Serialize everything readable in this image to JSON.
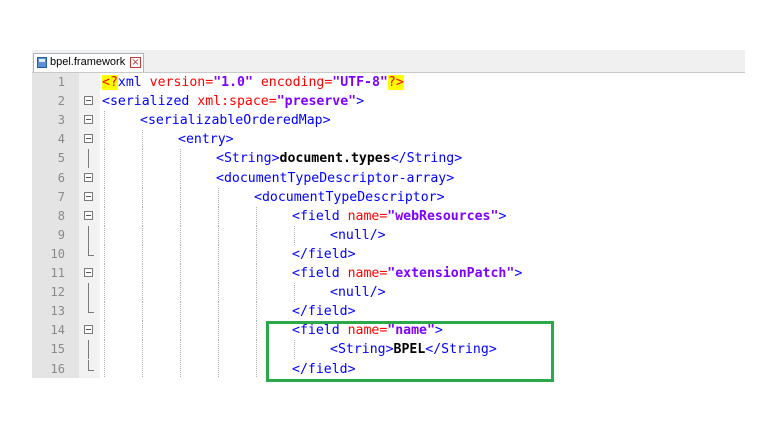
{
  "tab": {
    "label": "bpel.framework",
    "close_glyph": "×",
    "icon": "xml-file-icon",
    "close_icon": "close-icon"
  },
  "lines": [
    {
      "n": "1",
      "fold": "none",
      "indent": 0,
      "parts": [
        {
          "t": "<?",
          "c": "pi"
        },
        {
          "t": "xml",
          "c": "tag"
        },
        {
          "t": " version=",
          "c": "attr"
        },
        {
          "t": "\"1.0\"",
          "c": "val"
        },
        {
          "t": " encoding=",
          "c": "attr"
        },
        {
          "t": "\"UTF-8\"",
          "c": "val"
        },
        {
          "t": "?>",
          "c": "pi"
        }
      ]
    },
    {
      "n": "2",
      "fold": "box",
      "indent": 0,
      "parts": [
        {
          "t": "<serialized",
          "c": "tag"
        },
        {
          "t": " xml:space=",
          "c": "attr"
        },
        {
          "t": "\"preserve\"",
          "c": "val"
        },
        {
          "t": ">",
          "c": "tag"
        }
      ]
    },
    {
      "n": "3",
      "fold": "box",
      "indent": 1,
      "parts": [
        {
          "t": "<serializableOrderedMap>",
          "c": "tag"
        }
      ]
    },
    {
      "n": "4",
      "fold": "box",
      "indent": 2,
      "parts": [
        {
          "t": "<entry>",
          "c": "tag"
        }
      ]
    },
    {
      "n": "5",
      "fold": "line",
      "indent": 3,
      "parts": [
        {
          "t": "<String>",
          "c": "tag"
        },
        {
          "t": "document.types",
          "c": "plain"
        },
        {
          "t": "</String>",
          "c": "tag"
        }
      ]
    },
    {
      "n": "6",
      "fold": "box",
      "indent": 3,
      "parts": [
        {
          "t": "<documentTypeDescriptor-array>",
          "c": "tag"
        }
      ]
    },
    {
      "n": "7",
      "fold": "box",
      "indent": 4,
      "parts": [
        {
          "t": "<documentTypeDescriptor>",
          "c": "tag"
        }
      ]
    },
    {
      "n": "8",
      "fold": "box",
      "indent": 5,
      "parts": [
        {
          "t": "<field",
          "c": "tag"
        },
        {
          "t": " name=",
          "c": "attr"
        },
        {
          "t": "\"webResources\"",
          "c": "val"
        },
        {
          "t": ">",
          "c": "tag"
        }
      ]
    },
    {
      "n": "9",
      "fold": "line",
      "indent": 6,
      "parts": [
        {
          "t": "<null/>",
          "c": "tag"
        }
      ]
    },
    {
      "n": "10",
      "fold": "end",
      "indent": 5,
      "parts": [
        {
          "t": "</field>",
          "c": "tag"
        }
      ]
    },
    {
      "n": "11",
      "fold": "box",
      "indent": 5,
      "parts": [
        {
          "t": "<field",
          "c": "tag"
        },
        {
          "t": " name=",
          "c": "attr"
        },
        {
          "t": "\"extensionPatch\"",
          "c": "val"
        },
        {
          "t": ">",
          "c": "tag"
        }
      ]
    },
    {
      "n": "12",
      "fold": "line",
      "indent": 6,
      "parts": [
        {
          "t": "<null/>",
          "c": "tag"
        }
      ]
    },
    {
      "n": "13",
      "fold": "end",
      "indent": 5,
      "parts": [
        {
          "t": "</field>",
          "c": "tag"
        }
      ]
    },
    {
      "n": "14",
      "fold": "box",
      "indent": 5,
      "parts": [
        {
          "t": "<field",
          "c": "tag"
        },
        {
          "t": " name=",
          "c": "attr"
        },
        {
          "t": "\"name\"",
          "c": "val"
        },
        {
          "t": ">",
          "c": "tag"
        }
      ]
    },
    {
      "n": "15",
      "fold": "line",
      "indent": 6,
      "parts": [
        {
          "t": "<String>",
          "c": "tag"
        },
        {
          "t": "BPEL",
          "c": "plain"
        },
        {
          "t": "</String>",
          "c": "tag"
        }
      ]
    },
    {
      "n": "16",
      "fold": "end",
      "indent": 5,
      "parts": [
        {
          "t": "</field>",
          "c": "tag"
        }
      ]
    }
  ],
  "colors": {
    "highlight_box": "#2aa84a",
    "tag": "#0000ff",
    "attribute": "#ff0000",
    "value": "#8000ff",
    "pi_background": "#ffff00"
  }
}
